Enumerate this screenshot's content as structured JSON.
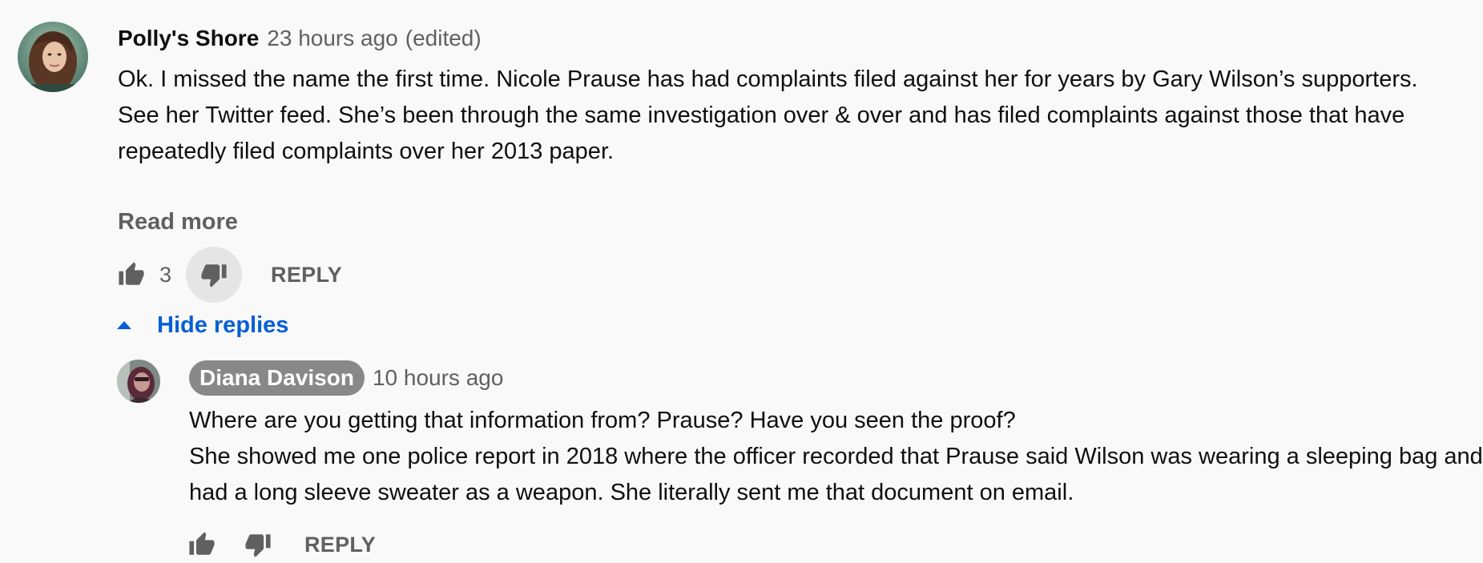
{
  "comment": {
    "author": "Polly's Shore",
    "timestamp": "23 hours ago",
    "edited": "(edited)",
    "text": "Ok. I missed the name the first time. Nicole Prause has had complaints filed against her for years by Gary Wilson’s supporters. See her Twitter feed. She’s been through the same investigation over & over and has filed complaints against those that have repeatedly filed complaints over her 2013 paper.",
    "read_more_label": "Read more",
    "like_count": "3",
    "reply_label": "REPLY",
    "hide_replies_label": "Hide replies",
    "avatar_icon": "avatar-photo"
  },
  "reply": {
    "author": "Diana Davison",
    "timestamp": "10 hours ago",
    "text_line1": "Where are you getting that information from? Prause? Have you seen the proof?",
    "text_line2": "She showed me one police report in 2018 where the officer recorded that Prause said Wilson was wearing a sleeping bag and had a long sleeve sweater as a weapon. She literally sent me that document on email.",
    "reply_label": "REPLY",
    "avatar_icon": "avatar-photo"
  },
  "icons": {
    "like": "thumbs-up-icon",
    "dislike": "thumbs-down-icon",
    "collapse": "caret-up-icon"
  },
  "colors": {
    "background": "#f9f9f9",
    "link_blue": "#065fd4",
    "secondary_text": "#606060",
    "author_pill": "#888888"
  }
}
